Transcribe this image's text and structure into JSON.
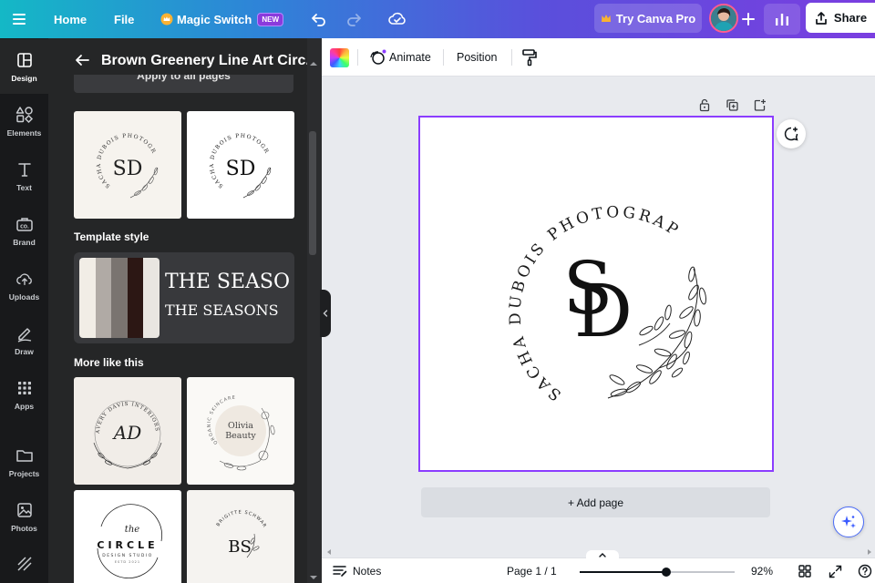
{
  "topbar": {
    "home_label": "Home",
    "file_label": "File",
    "magic_switch_label": "Magic Switch",
    "new_badge": "NEW",
    "try_pro_label": "Try Canva Pro",
    "share_label": "Share"
  },
  "rail": {
    "items": [
      {
        "label": "Design",
        "icon": "layout-icon"
      },
      {
        "label": "Elements",
        "icon": "shapes-icon"
      },
      {
        "label": "Text",
        "icon": "text-icon"
      },
      {
        "label": "Brand",
        "icon": "brand-icon"
      },
      {
        "label": "Uploads",
        "icon": "upload-icon"
      },
      {
        "label": "Draw",
        "icon": "pen-icon"
      },
      {
        "label": "Apps",
        "icon": "apps-icon"
      },
      {
        "label": "Projects",
        "icon": "folder-icon"
      },
      {
        "label": "Photos",
        "icon": "image-icon"
      }
    ]
  },
  "panel": {
    "title": "Brown Greenery Line Art Circ...",
    "apply_all_partial": "Apply to all pages",
    "template_style_label": "Template style",
    "style_preview_line1": "THE SEASO",
    "style_preview_line2": "THE SEASONS",
    "style_swatches": [
      "#f1ede6",
      "#b0aaa5",
      "#7a7470",
      "#2c1714",
      "#e9e6e1"
    ],
    "more_like_this_label": "More like this",
    "thumb_sd_text": "SD",
    "thumb_sd_ring": "SACHA DUBOIS PHOTOGRAPHY",
    "thumb_ad_text": "AD",
    "thumb_ad_ring": "AVERY DAVIS INTERIORS",
    "thumb_olivia_ring": "ORGANIC SKINCARE",
    "thumb_olivia_name1": "Olivia",
    "thumb_olivia_name2": "Beauty",
    "thumb_circle_script": "the",
    "thumb_circle_word": "CIRCLE",
    "thumb_circle_sub": "DESIGN STUDIO",
    "thumb_circle_est": "ESTD 2021",
    "thumb_bs_text": "BS",
    "thumb_bs_ring": "BRIGITTE SCHWARTZ"
  },
  "context_toolbar": {
    "animate_label": "Animate",
    "position_label": "Position"
  },
  "design": {
    "ring_text": "SACHA DUBOIS PHOTOGRAPHY",
    "monogram_s": "S",
    "monogram_d": "D"
  },
  "canvas": {
    "add_page_label": "+ Add page"
  },
  "bottombar": {
    "notes_label": "Notes",
    "page_indicator": "Page 1 / 1",
    "zoom_label": "92%",
    "zoom_fraction": 0.56
  },
  "colors": {
    "accent_purple": "#8b3dff",
    "rail_bg": "#18191b",
    "panel_bg": "#252627"
  }
}
